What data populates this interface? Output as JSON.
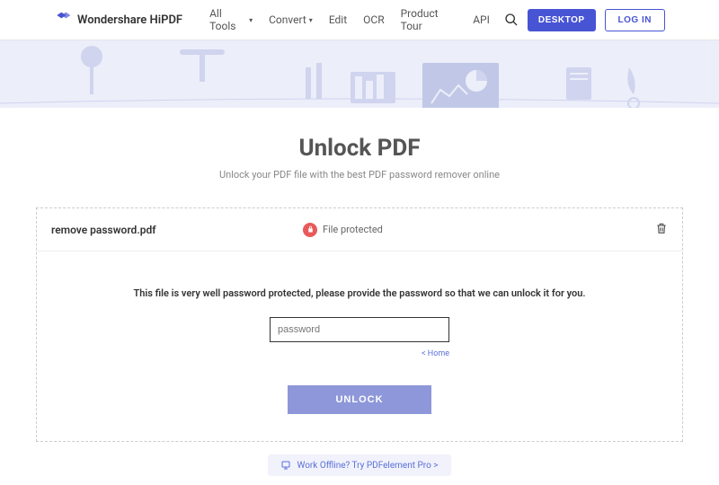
{
  "brand": {
    "name": "Wondershare HiPDF"
  },
  "nav": {
    "all_tools": "All Tools",
    "convert": "Convert",
    "edit": "Edit",
    "ocr": "OCR",
    "product_tour": "Product Tour",
    "api": "API"
  },
  "header_buttons": {
    "desktop": "DESKTOP",
    "login": "LOG IN"
  },
  "page": {
    "title": "Unlock PDF",
    "subtitle": "Unlock your PDF file with the best PDF password remover online"
  },
  "file": {
    "name": "remove password.pdf",
    "status": "File protected"
  },
  "form": {
    "instruction": "This file is very well password protected, please provide the password so that we can unlock it for you.",
    "placeholder": "password",
    "home_link": "< Home",
    "unlock_label": "UNLOCK"
  },
  "footer": {
    "offline_cta": "Work Offline? Try PDFelement Pro >"
  }
}
